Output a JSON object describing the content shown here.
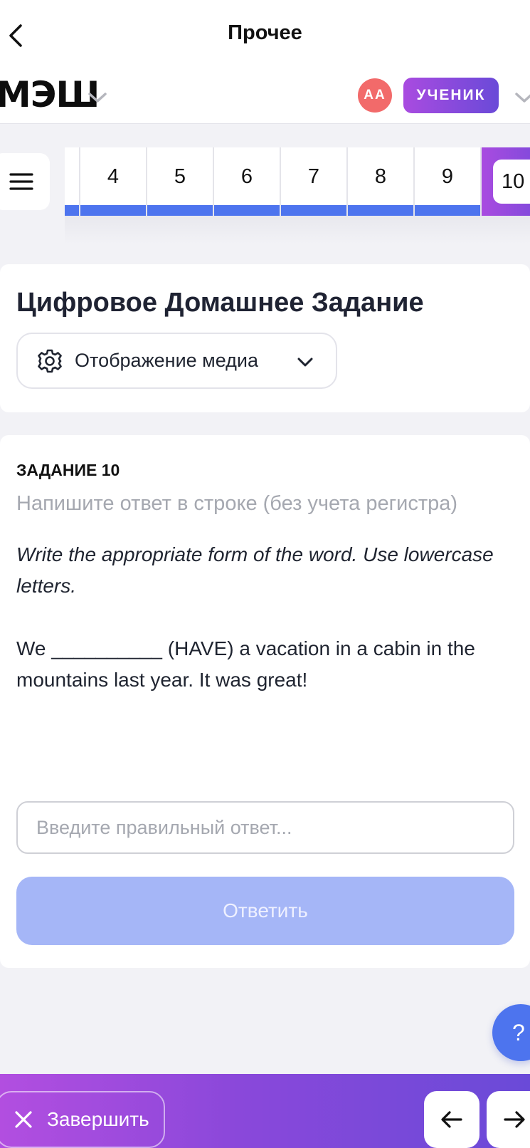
{
  "nav": {
    "title": "Прочее",
    "back_icon": "chevron-left-icon"
  },
  "header": {
    "logo_text": "МЭШ",
    "avatar_initials": "АА",
    "role_badge": "УЧЕНИК",
    "colors": {
      "avatar": "#f26a6a",
      "badge_start": "#a94be0",
      "badge_end": "#6a4ad8"
    }
  },
  "task_strip": {
    "steps": [
      "4",
      "5",
      "6",
      "7",
      "8",
      "9"
    ],
    "active_step": "10",
    "completed_color": "#4d74ee"
  },
  "page": {
    "title": "Цифровое Домашнее Задание",
    "media_dropdown_label": "Отображение медиа"
  },
  "task": {
    "label": "ЗАДАНИЕ 10",
    "hint": "Напишите ответ в строке (без учета регистра)",
    "instruction": "Write the appropriate form of the word. Use lowercase letters.",
    "sentence": "We  __________ (HAVE) a vacation in a cabin in the mountains last year. It was great!",
    "input_placeholder": "Введите правильный ответ...",
    "submit_label": "Ответить"
  },
  "help": {
    "label": "?"
  },
  "bottom_bar": {
    "finish_label": "Завершить"
  }
}
